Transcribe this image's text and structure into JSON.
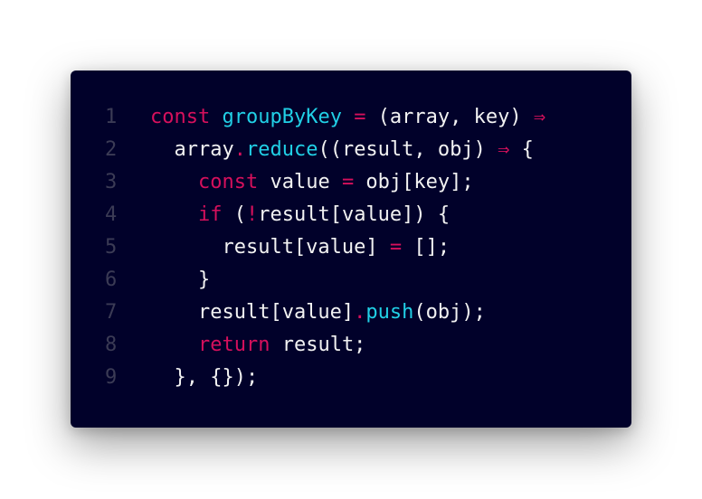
{
  "colors": {
    "background": "#01012a",
    "keyword": "#d6105c",
    "function": "#21d0e6",
    "text": "#f2f2f2",
    "line_number": "#3b3b55"
  },
  "lines": [
    {
      "number": "1",
      "tokens": [
        {
          "type": "kw",
          "text": "const"
        },
        {
          "type": "id",
          "text": " "
        },
        {
          "type": "fn",
          "text": "groupByKey"
        },
        {
          "type": "id",
          "text": " "
        },
        {
          "type": "op",
          "text": "="
        },
        {
          "type": "id",
          "text": " (array, key) "
        },
        {
          "type": "op",
          "text": "⇒"
        }
      ]
    },
    {
      "number": "2",
      "tokens": [
        {
          "type": "id",
          "text": "  array"
        },
        {
          "type": "op",
          "text": "."
        },
        {
          "type": "fn",
          "text": "reduce"
        },
        {
          "type": "id",
          "text": "((result, obj) "
        },
        {
          "type": "op",
          "text": "⇒"
        },
        {
          "type": "id",
          "text": " {"
        }
      ]
    },
    {
      "number": "3",
      "tokens": [
        {
          "type": "id",
          "text": "    "
        },
        {
          "type": "kw",
          "text": "const"
        },
        {
          "type": "id",
          "text": " value "
        },
        {
          "type": "op",
          "text": "="
        },
        {
          "type": "id",
          "text": " obj[key];"
        }
      ]
    },
    {
      "number": "4",
      "tokens": [
        {
          "type": "id",
          "text": "    "
        },
        {
          "type": "kw",
          "text": "if"
        },
        {
          "type": "id",
          "text": " ("
        },
        {
          "type": "op",
          "text": "!"
        },
        {
          "type": "id",
          "text": "result[value]) {"
        }
      ]
    },
    {
      "number": "5",
      "tokens": [
        {
          "type": "id",
          "text": "      result[value] "
        },
        {
          "type": "op",
          "text": "="
        },
        {
          "type": "id",
          "text": " [];"
        }
      ]
    },
    {
      "number": "6",
      "tokens": [
        {
          "type": "id",
          "text": "    }"
        }
      ]
    },
    {
      "number": "7",
      "tokens": [
        {
          "type": "id",
          "text": "    result[value]"
        },
        {
          "type": "op",
          "text": "."
        },
        {
          "type": "fn",
          "text": "push"
        },
        {
          "type": "id",
          "text": "(obj);"
        }
      ]
    },
    {
      "number": "8",
      "tokens": [
        {
          "type": "id",
          "text": "    "
        },
        {
          "type": "kw",
          "text": "return"
        },
        {
          "type": "id",
          "text": " result;"
        }
      ]
    },
    {
      "number": "9",
      "tokens": [
        {
          "type": "id",
          "text": "  }, {});"
        }
      ]
    }
  ]
}
